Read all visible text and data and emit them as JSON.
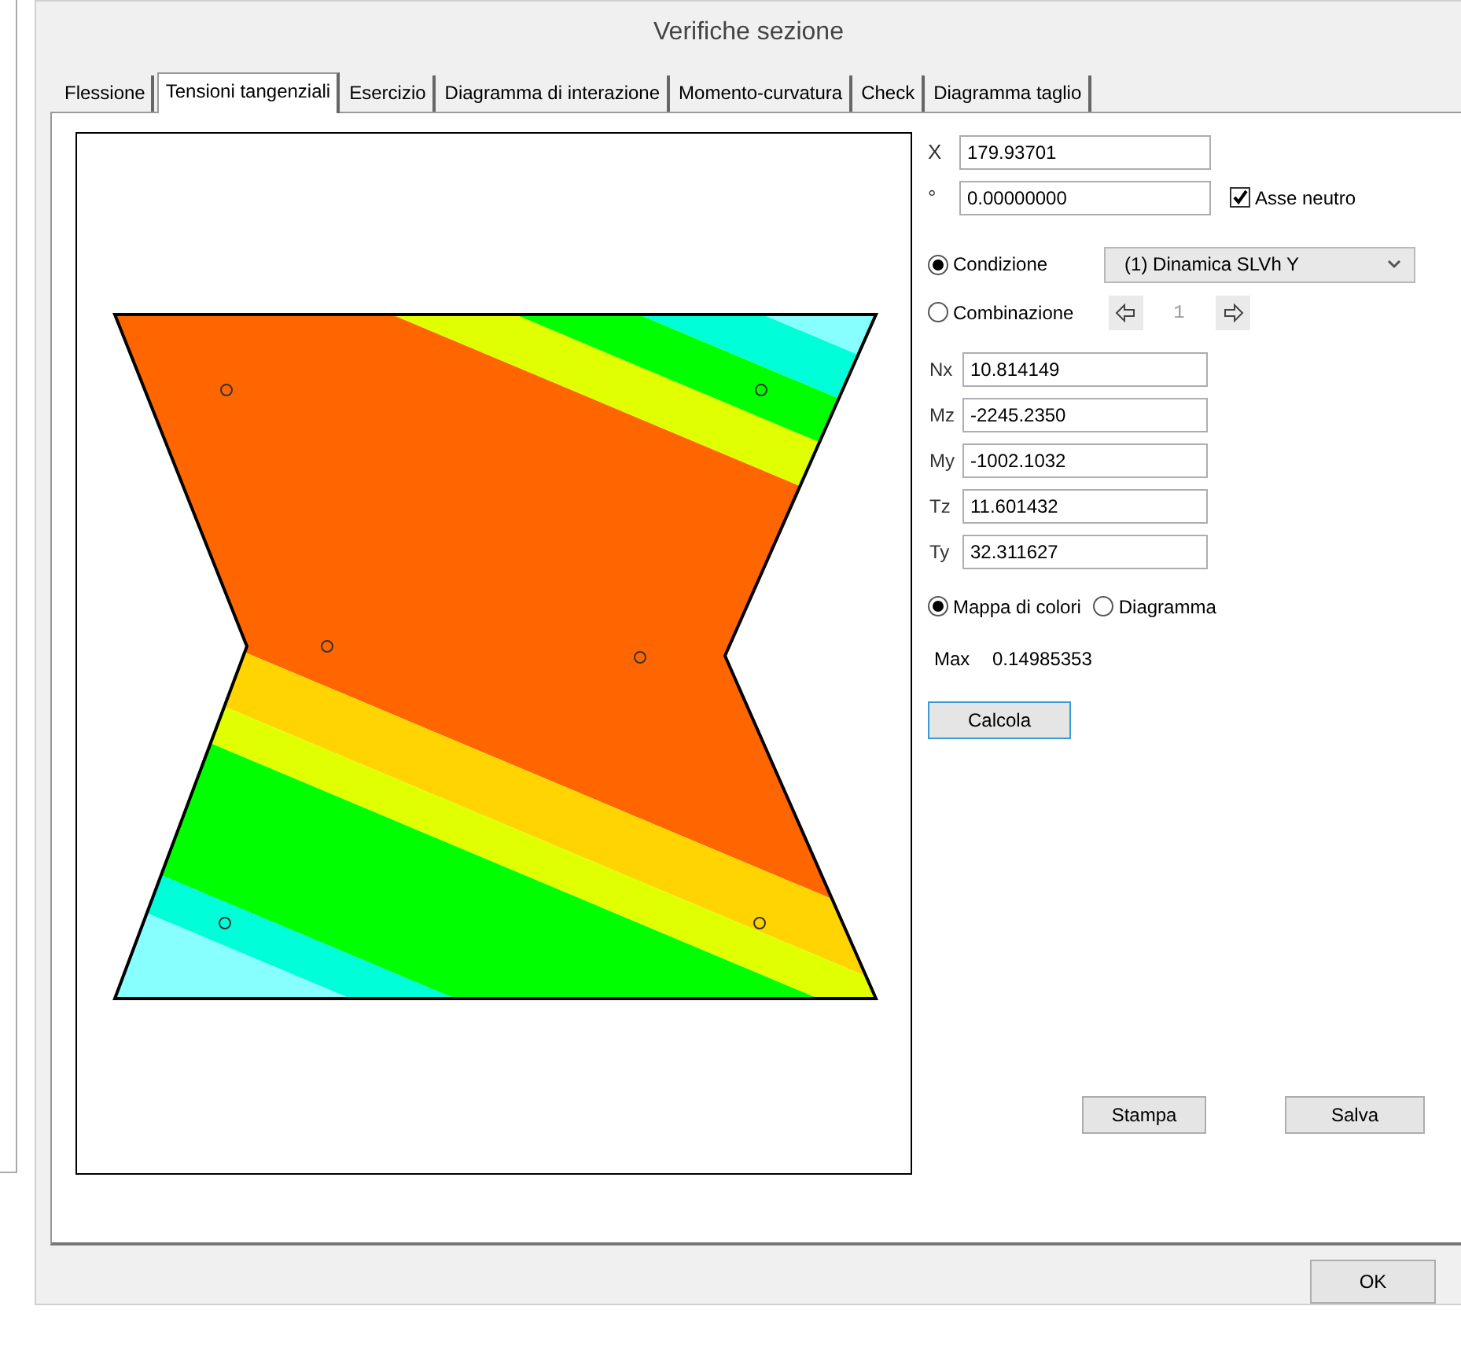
{
  "window": {
    "title": "Verifiche sezione"
  },
  "tabs": [
    {
      "label": "Flessione",
      "selected": false
    },
    {
      "label": "Tensioni tangenziali",
      "selected": true
    },
    {
      "label": "Esercizio",
      "selected": false
    },
    {
      "label": "Diagramma di interazione",
      "selected": false
    },
    {
      "label": "Momento-curvatura",
      "selected": false
    },
    {
      "label": "Check",
      "selected": false
    },
    {
      "label": "Diagramma taglio",
      "selected": false
    }
  ],
  "position": {
    "x_label": "X",
    "x_value": "179.93701",
    "angle_label": "°",
    "angle_value": "0.00000000",
    "neutral_axis": {
      "label": "Asse neutro",
      "checked": true
    }
  },
  "source": [
    {
      "label": "Condizione",
      "selected": true
    },
    {
      "label": "Combinazione",
      "selected": false
    }
  ],
  "condition_dropdown": {
    "value": "(1) Dinamica SLVh Y"
  },
  "combination_nav": {
    "index": "1",
    "disabled": true
  },
  "forces": [
    {
      "label": "Nx",
      "value": "10.814149"
    },
    {
      "label": "Mz",
      "value": "-2245.2350"
    },
    {
      "label": "My",
      "value": "-1002.1032"
    },
    {
      "label": "Tz",
      "value": "11.601432"
    },
    {
      "label": "Ty",
      "value": "32.311627"
    }
  ],
  "display_mode": [
    {
      "label": "Mappa di colori",
      "selected": true
    },
    {
      "label": "Diagramma",
      "selected": false
    }
  ],
  "max": {
    "label": "Max",
    "value": "0.14985353"
  },
  "buttons": {
    "calculate": "Calcola",
    "print": "Stampa",
    "save": "Salva",
    "ok": "OK"
  }
}
